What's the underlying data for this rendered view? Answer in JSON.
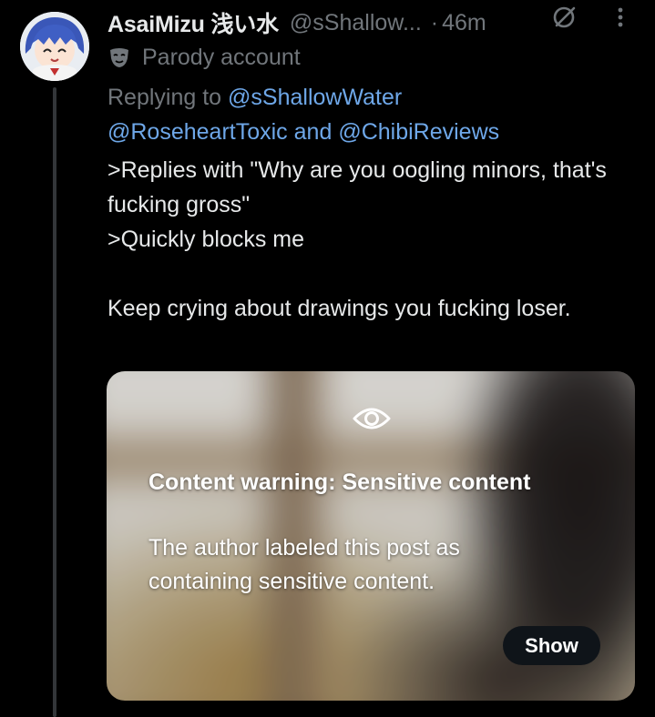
{
  "author": {
    "display_name": "AsaiMizu 浅い水",
    "handle": "@sShallow...",
    "time_separator": "·",
    "time": "46m",
    "label": "Parody account"
  },
  "reply_to": {
    "prefix": "Replying to",
    "users": [
      "@sShallowWater",
      "@RoseheartToxic",
      "@ChibiReviews"
    ],
    "conjunction": "and"
  },
  "tweet": {
    "lines": [
      ">Replies with \"Why are you oogling minors, that's fucking gross\"",
      ">Quickly blocks me",
      "Keep crying about drawings you fucking loser."
    ]
  },
  "media": {
    "warning_title": "Content warning: Sensitive content",
    "warning_description": "The author labeled this post as containing sensitive content.",
    "show_label": "Show"
  },
  "icons": {
    "grok": "grok-icon",
    "more": "more-icon",
    "parody": "parody-mask-icon",
    "eye": "eye-icon"
  },
  "colors": {
    "background": "#000000",
    "text": "#e7e9ea",
    "secondary": "#71767b",
    "link": "#6ea7e8"
  }
}
